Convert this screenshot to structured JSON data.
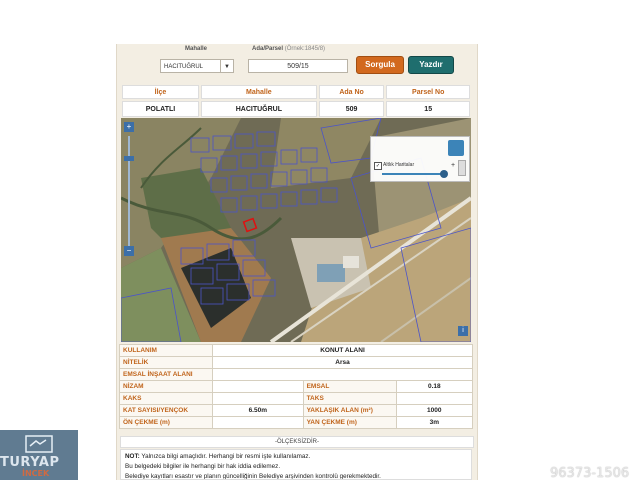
{
  "query": {
    "mahalle_label": "Mahalle",
    "ada_parsel_label": "Ada/Parsel",
    "ada_parsel_hint": "(Örnek:1845/8)",
    "mahalle_value": "HACITUĞRUL",
    "ada_parsel_value": "509/15",
    "search_button": "Sorgula",
    "print_button": "Yazdır"
  },
  "info": {
    "headers": [
      "İlçe",
      "Mahalle",
      "Ada No",
      "Parsel No"
    ],
    "values": [
      "POLATLI",
      "HACITUĞRUL",
      "509",
      "15"
    ]
  },
  "map": {
    "layer_label": "Altlık Haritalar",
    "zoom_in": "+",
    "zoom_out": "−",
    "info_glyph": "i"
  },
  "attributes": {
    "kullanim_label": "KULLANIM",
    "kullanim_value": "KONUT ALANI",
    "nitelik_label": "NİTELİK",
    "nitelik_value": "Arsa",
    "emsal_insaat_label": "EMSAL İNŞAAT ALANI",
    "emsal_insaat_value": "",
    "nizam_label": "NİZAM",
    "nizam_value": "",
    "emsal_label": "EMSAL",
    "emsal_value": "0.18",
    "kaks_label": "KAKS",
    "kaks_value": "",
    "taks_label": "TAKS",
    "taks_value": "",
    "kat_label": "KAT SAYISI/YENÇOK",
    "kat_value": "6.50m",
    "alan_label": "YAKLAŞIK ALAN (m²)",
    "alan_value": "1000",
    "on_cekme_label": "ÖN ÇEKME (m)",
    "on_cekme_value": "",
    "yan_cekme_label": "YAN ÇEKME (m)",
    "yan_cekme_value": "3m"
  },
  "scale_text": "-ÖLÇEKSİZDİR-",
  "notes": {
    "line1_prefix": "NOT:",
    "line1": " Yalnızca bilgi amaçlıdır. Herhangi bir resmi işte kullanılamaz.",
    "line2": "Bu belgedeki bilgiler ile herhangi bir hak iddia edilemez.",
    "line3": "Belediye kayıtları esastır ve planın güncelliğinin Belediye arşivinden kontrolü gerekmektedir."
  },
  "overlay": {
    "logo_text": "TURYAP",
    "logo_sub": "İNCEK",
    "watermark": "96373-1506"
  },
  "colors": {
    "accent_orange": "#d2691e",
    "accent_teal": "#1f6e6e",
    "header_text": "#c0641b",
    "parcel_outline": "#4b54c9",
    "selected_parcel": "#e01010"
  }
}
